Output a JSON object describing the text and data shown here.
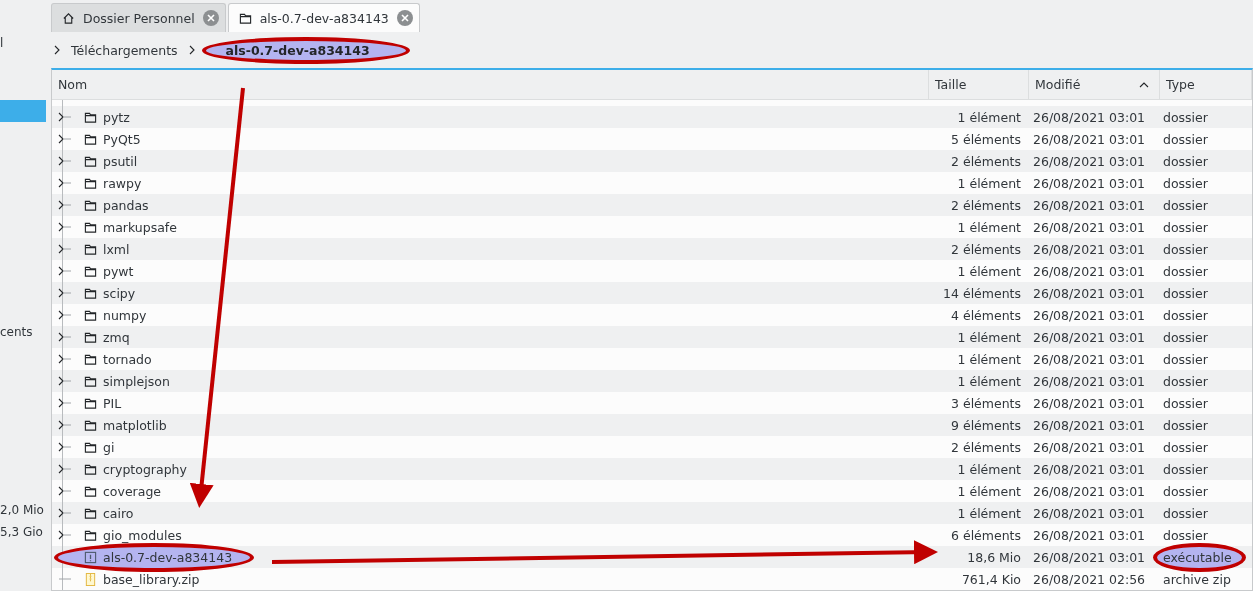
{
  "sidebar": {
    "items": [
      {
        "label": "l",
        "selected": false
      },
      {
        "selected": true
      },
      {
        "label": "cents",
        "selected": false
      },
      {
        "label": "2,0 Mio",
        "selected": false
      },
      {
        "label": "5,3 Gio",
        "selected": false
      }
    ]
  },
  "tabs": [
    {
      "label": "Dossier Personnel",
      "kind": "home",
      "selected": false
    },
    {
      "label": "als-0.7-dev-a834143",
      "kind": "folder",
      "selected": true
    }
  ],
  "breadcrumb": [
    {
      "label": "Téléchargements",
      "annotated": false
    },
    {
      "label": "als-0.7-dev-a834143",
      "annotated": true
    }
  ],
  "table": {
    "columns": [
      {
        "label": "Nom",
        "sorted": false
      },
      {
        "label": "Taille",
        "sorted": false
      },
      {
        "label": "Modifié",
        "sorted": true
      },
      {
        "label": "Type",
        "sorted": false
      }
    ],
    "rows": [
      {
        "name": "pytz",
        "kind": "folder",
        "size": "1 élément",
        "modified": "26/08/2021 03:01",
        "type": "dossier",
        "annotated": false
      },
      {
        "name": "PyQt5",
        "kind": "folder",
        "size": "5 éléments",
        "modified": "26/08/2021 03:01",
        "type": "dossier",
        "annotated": false
      },
      {
        "name": "psutil",
        "kind": "folder",
        "size": "2 éléments",
        "modified": "26/08/2021 03:01",
        "type": "dossier",
        "annotated": false
      },
      {
        "name": "rawpy",
        "kind": "folder",
        "size": "1 élément",
        "modified": "26/08/2021 03:01",
        "type": "dossier",
        "annotated": false
      },
      {
        "name": "pandas",
        "kind": "folder",
        "size": "2 éléments",
        "modified": "26/08/2021 03:01",
        "type": "dossier",
        "annotated": false
      },
      {
        "name": "markupsafe",
        "kind": "folder",
        "size": "1 élément",
        "modified": "26/08/2021 03:01",
        "type": "dossier",
        "annotated": false
      },
      {
        "name": "lxml",
        "kind": "folder",
        "size": "2 éléments",
        "modified": "26/08/2021 03:01",
        "type": "dossier",
        "annotated": false
      },
      {
        "name": "pywt",
        "kind": "folder",
        "size": "1 élément",
        "modified": "26/08/2021 03:01",
        "type": "dossier",
        "annotated": false
      },
      {
        "name": "scipy",
        "kind": "folder",
        "size": "14 éléments",
        "modified": "26/08/2021 03:01",
        "type": "dossier",
        "annotated": false
      },
      {
        "name": "numpy",
        "kind": "folder",
        "size": "4 éléments",
        "modified": "26/08/2021 03:01",
        "type": "dossier",
        "annotated": false
      },
      {
        "name": "zmq",
        "kind": "folder",
        "size": "1 élément",
        "modified": "26/08/2021 03:01",
        "type": "dossier",
        "annotated": false
      },
      {
        "name": "tornado",
        "kind": "folder",
        "size": "1 élément",
        "modified": "26/08/2021 03:01",
        "type": "dossier",
        "annotated": false
      },
      {
        "name": "simplejson",
        "kind": "folder",
        "size": "1 élément",
        "modified": "26/08/2021 03:01",
        "type": "dossier",
        "annotated": false
      },
      {
        "name": "PIL",
        "kind": "folder",
        "size": "3 éléments",
        "modified": "26/08/2021 03:01",
        "type": "dossier",
        "annotated": false
      },
      {
        "name": "matplotlib",
        "kind": "folder",
        "size": "9 éléments",
        "modified": "26/08/2021 03:01",
        "type": "dossier",
        "annotated": false
      },
      {
        "name": "gi",
        "kind": "folder",
        "size": "2 éléments",
        "modified": "26/08/2021 03:01",
        "type": "dossier",
        "annotated": false
      },
      {
        "name": "cryptography",
        "kind": "folder",
        "size": "1 élément",
        "modified": "26/08/2021 03:01",
        "type": "dossier",
        "annotated": false
      },
      {
        "name": "coverage",
        "kind": "folder",
        "size": "1 élément",
        "modified": "26/08/2021 03:01",
        "type": "dossier",
        "annotated": false
      },
      {
        "name": "cairo",
        "kind": "folder",
        "size": "1 élément",
        "modified": "26/08/2021 03:01",
        "type": "dossier",
        "annotated": false
      },
      {
        "name": "gio_modules",
        "kind": "folder",
        "size": "6 éléments",
        "modified": "26/08/2021 03:01",
        "type": "dossier",
        "annotated": false
      },
      {
        "name": "als-0.7-dev-a834143",
        "kind": "executable",
        "size": "18,6 Mio",
        "modified": "26/08/2021 03:01",
        "type": "exécutable",
        "annotated": true
      },
      {
        "name": "base_library.zip",
        "kind": "zip",
        "size": "761,4 Kio",
        "modified": "26/08/2021 02:56",
        "type": "archive zip",
        "annotated": false
      }
    ]
  }
}
